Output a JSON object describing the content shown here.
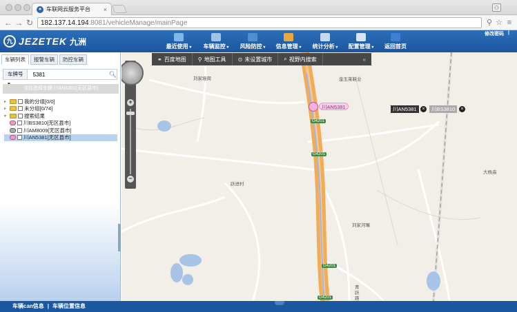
{
  "browser": {
    "tab_title": "车联网云服务平台",
    "address_host": "182.137.14.194",
    "address_path": ":8081/vehicleManage/mainPage"
  },
  "header": {
    "logo_text": "JEZETEK",
    "logo_cn": "九洲",
    "menu": [
      {
        "label": "最近使用",
        "has_dropdown": true
      },
      {
        "label": "车辆监控",
        "has_dropdown": true
      },
      {
        "label": "风险防控",
        "has_dropdown": true
      },
      {
        "label": "信息管理",
        "has_dropdown": true
      },
      {
        "label": "统计分析",
        "has_dropdown": true
      },
      {
        "label": "配置管理",
        "has_dropdown": true
      },
      {
        "label": "返回首页",
        "has_dropdown": false
      }
    ],
    "change_password": "修改密码",
    "divider": "|"
  },
  "left_panel": {
    "tabs": [
      {
        "label": "车辆列表",
        "active": true
      },
      {
        "label": "报警车辆",
        "active": false
      },
      {
        "label": "防控车辆",
        "active": false
      }
    ],
    "search": {
      "type_label": "车牌号",
      "dropdown_icon": "▾",
      "query": "5381"
    },
    "selected_label": "当前选择车辆:川AN5381[无区县市]",
    "tree": [
      {
        "label": "我的分组[0/0]",
        "type": "folder",
        "expanded": false
      },
      {
        "label": "未分组[0/74]",
        "type": "folder",
        "expanded": false
      },
      {
        "label": "搜索结果",
        "type": "folder",
        "expanded": true
      },
      {
        "label": "川BS3810[无区县市]",
        "type": "vehicle",
        "status": "active"
      },
      {
        "label": "川AM8009[无区县市]",
        "type": "vehicle",
        "status": "offline"
      },
      {
        "label": "川AN5381[无区县市]",
        "type": "vehicle",
        "status": "active",
        "selected": true
      }
    ]
  },
  "map": {
    "toolbar": [
      "百度地图",
      "地图工具",
      "未设置城市",
      "视野内搜索"
    ],
    "labels": [
      "刘家境周",
      "金玉莱鞋业",
      "跃进村",
      "大杨庙",
      "刘家河嘴",
      "青跃路"
    ],
    "road_shields": [
      "G4201",
      "G4201",
      "G4201",
      "G4201"
    ],
    "vehicle_tags": [
      {
        "plate": "川AN5381",
        "tone": "pink"
      },
      {
        "plate": "川AN5381",
        "tone": "dark"
      },
      {
        "plate": "川BS3810",
        "tone": "gray"
      }
    ],
    "zoom_in": "+",
    "zoom_out": "−",
    "collapse_icon": "«"
  },
  "footer": {
    "link1": "车辆can信息",
    "divider": "|",
    "link2": "车辆位置信息"
  },
  "colors": {
    "header": "#1b56a0",
    "highway": "#f2ab57",
    "water": "#a7c4e6"
  }
}
